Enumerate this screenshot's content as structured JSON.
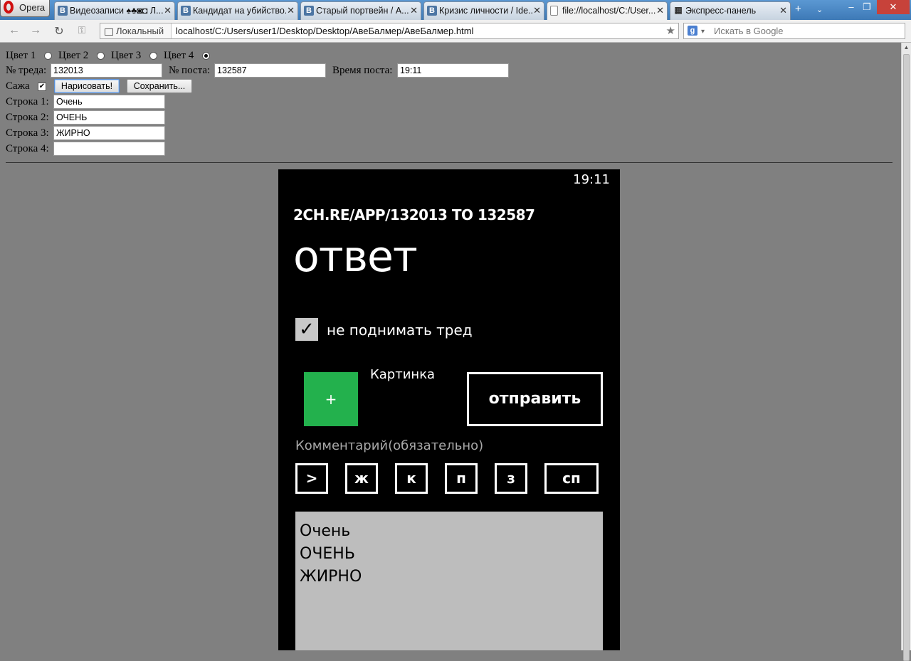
{
  "browser": {
    "opera_label": "Opera",
    "tabs": [
      {
        "icon": "vk-icon",
        "title": "Видеозаписи ♠♣◙◘ Л...",
        "active": false
      },
      {
        "icon": "vk-icon",
        "title": "Кандидат на убийство...",
        "active": false
      },
      {
        "icon": "vk-icon",
        "title": "Старый портвейн / А...",
        "active": false
      },
      {
        "icon": "vk-icon",
        "title": "Кризис личности / Ide...",
        "active": false
      },
      {
        "icon": "document-icon",
        "title": "file://localhost/C:/User...",
        "active": true
      },
      {
        "icon": "speed-dial-icon",
        "title": "Экспресс-панель",
        "active": false
      }
    ],
    "site_label": "Локальный",
    "url": "localhost/C:/Users/user1/Desktop/Desktop/АвеБалмер/АвеБалмер.html",
    "search_placeholder": "Искать в Google"
  },
  "form": {
    "colors": [
      {
        "label": "Цвет 1",
        "checked": false
      },
      {
        "label": "Цвет 2",
        "checked": false
      },
      {
        "label": "Цвет 3",
        "checked": false
      },
      {
        "label": "Цвет 4",
        "checked": true
      }
    ],
    "thread_label": "№ треда:",
    "thread_value": "132013",
    "post_label": "№ поста:",
    "post_value": "132587",
    "time_label": "Время поста:",
    "time_value": "19:11",
    "soot_label": "Сажа",
    "soot_checked": true,
    "draw_button": "Нарисовать!",
    "save_button": "Сохранить...",
    "lines": [
      {
        "label": "Строка 1:",
        "value": "Очень"
      },
      {
        "label": "Строка 2:",
        "value": "ОЧЕНЬ"
      },
      {
        "label": "Строка 3:",
        "value": "ЖИРНО"
      },
      {
        "label": "Строка 4:",
        "value": ""
      }
    ]
  },
  "phone": {
    "time": "19:11",
    "header": "2CH.RE/APP/132013  TO 132587",
    "title": "ответ",
    "checkbox_label": "не поднимать тред",
    "plus_label": "+",
    "picture_label": "Картинка",
    "send_label": "отправить",
    "comment_placeholder": "Комментарий(обязательно)",
    "format_keys": [
      ">",
      "ж",
      "к",
      "п",
      "з",
      "сп"
    ],
    "comment_lines": [
      "Очень",
      "ОЧЕНЬ",
      "ЖИРНО"
    ]
  },
  "colors": {
    "page_background": "#808080",
    "phone_background": "#000000",
    "accent_green": "#23b14d",
    "textarea_background": "#bdbdbd"
  }
}
